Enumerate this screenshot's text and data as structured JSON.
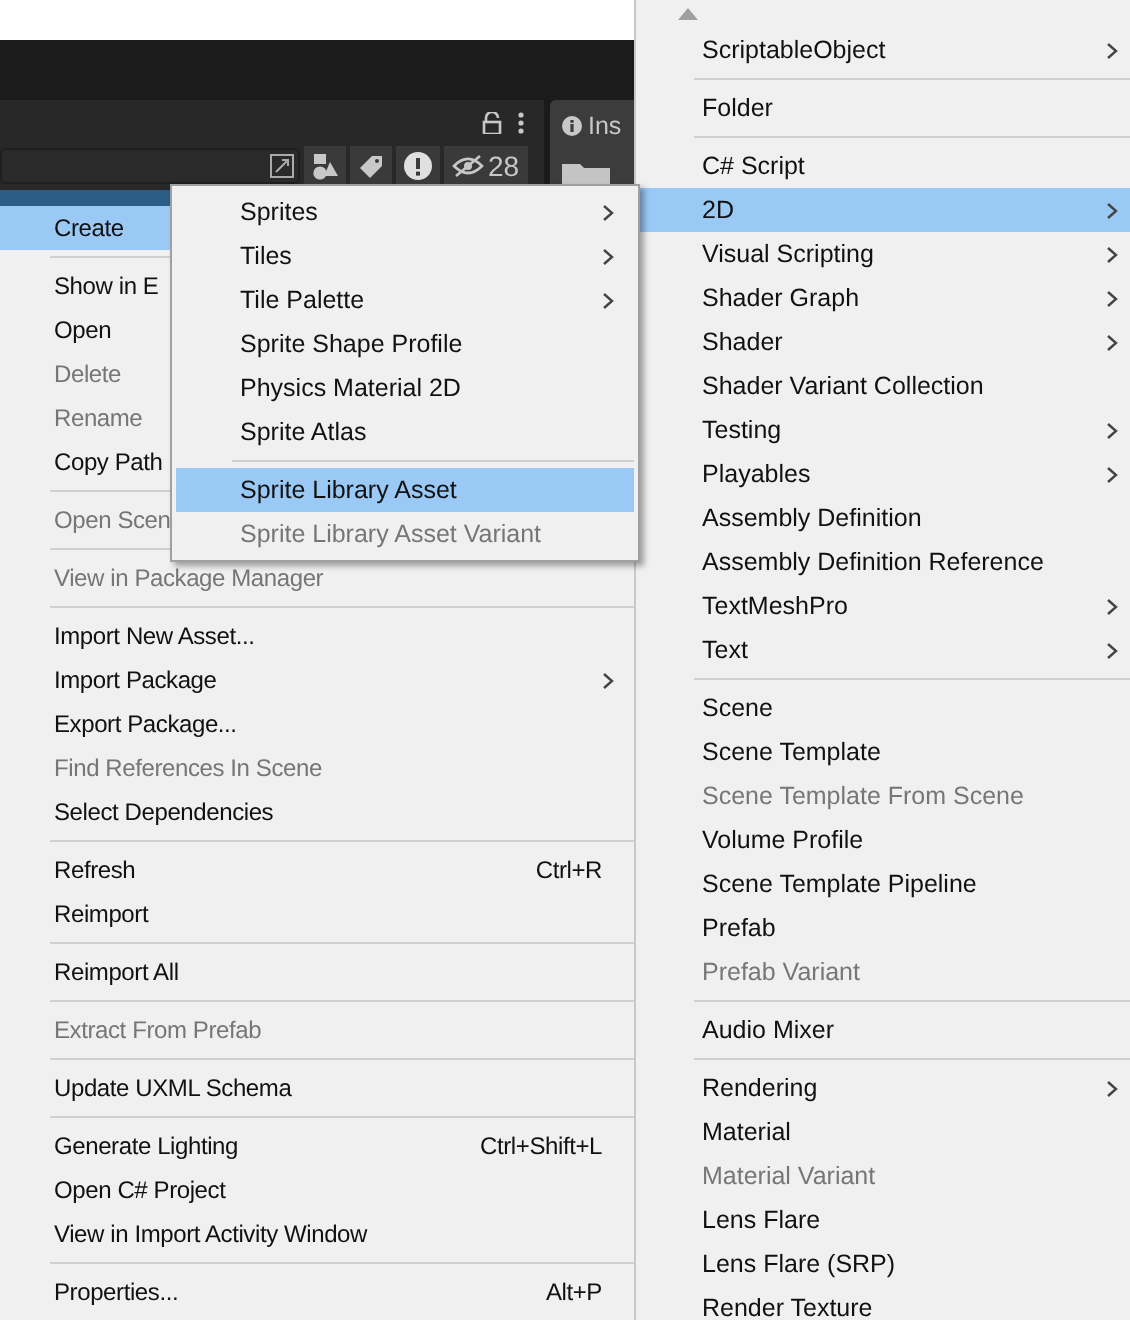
{
  "project_panel": {
    "hidden_count": "28"
  },
  "inspector_tab": {
    "label": "Ins"
  },
  "context_menu": {
    "items": [
      {
        "kind": "item",
        "label": "Create",
        "selected": true,
        "disabled": false,
        "submenu": true
      },
      {
        "kind": "separator"
      },
      {
        "kind": "item",
        "label": "Show in E",
        "selected": false,
        "disabled": false,
        "submenu": false
      },
      {
        "kind": "item",
        "label": "Open",
        "selected": false,
        "disabled": false,
        "submenu": false
      },
      {
        "kind": "item",
        "label": "Delete",
        "selected": false,
        "disabled": true,
        "submenu": false
      },
      {
        "kind": "item",
        "label": "Rename",
        "selected": false,
        "disabled": true,
        "submenu": false
      },
      {
        "kind": "item",
        "label": "Copy Path",
        "selected": false,
        "disabled": false,
        "submenu": false
      },
      {
        "kind": "separator"
      },
      {
        "kind": "item",
        "label": "Open Scen",
        "selected": false,
        "disabled": true,
        "submenu": false
      },
      {
        "kind": "separator"
      },
      {
        "kind": "item",
        "label": "View in Package Manager",
        "selected": false,
        "disabled": true,
        "submenu": false
      },
      {
        "kind": "separator"
      },
      {
        "kind": "item",
        "label": "Import New Asset...",
        "selected": false,
        "disabled": false,
        "submenu": false
      },
      {
        "kind": "item",
        "label": "Import Package",
        "selected": false,
        "disabled": false,
        "submenu": true
      },
      {
        "kind": "item",
        "label": "Export Package...",
        "selected": false,
        "disabled": false,
        "submenu": false
      },
      {
        "kind": "item",
        "label": "Find References In Scene",
        "selected": false,
        "disabled": true,
        "submenu": false
      },
      {
        "kind": "item",
        "label": "Select Dependencies",
        "selected": false,
        "disabled": false,
        "submenu": false
      },
      {
        "kind": "separator"
      },
      {
        "kind": "item",
        "label": "Refresh",
        "shortcut": "Ctrl+R",
        "selected": false,
        "disabled": false,
        "submenu": false
      },
      {
        "kind": "item",
        "label": "Reimport",
        "selected": false,
        "disabled": false,
        "submenu": false
      },
      {
        "kind": "separator"
      },
      {
        "kind": "item",
        "label": "Reimport All",
        "selected": false,
        "disabled": false,
        "submenu": false
      },
      {
        "kind": "separator"
      },
      {
        "kind": "item",
        "label": "Extract From Prefab",
        "selected": false,
        "disabled": true,
        "submenu": false
      },
      {
        "kind": "separator"
      },
      {
        "kind": "item",
        "label": "Update UXML Schema",
        "selected": false,
        "disabled": false,
        "submenu": false
      },
      {
        "kind": "separator"
      },
      {
        "kind": "item",
        "label": "Generate Lighting",
        "shortcut": "Ctrl+Shift+L",
        "selected": false,
        "disabled": false,
        "submenu": false
      },
      {
        "kind": "item",
        "label": "Open C# Project",
        "selected": false,
        "disabled": false,
        "submenu": false
      },
      {
        "kind": "item",
        "label": "View in Import Activity Window",
        "selected": false,
        "disabled": false,
        "submenu": false
      },
      {
        "kind": "separator"
      },
      {
        "kind": "item",
        "label": "Properties...",
        "shortcut": "Alt+P",
        "selected": false,
        "disabled": false,
        "submenu": false
      }
    ]
  },
  "create_submenu": {
    "items": [
      {
        "kind": "item",
        "label": "ScriptableObject",
        "selected": false,
        "disabled": false,
        "submenu": true
      },
      {
        "kind": "separator"
      },
      {
        "kind": "item",
        "label": "Folder",
        "selected": false,
        "disabled": false,
        "submenu": false
      },
      {
        "kind": "separator"
      },
      {
        "kind": "item",
        "label": "C# Script",
        "selected": false,
        "disabled": false,
        "submenu": false
      },
      {
        "kind": "item",
        "label": "2D",
        "selected": true,
        "disabled": false,
        "submenu": true
      },
      {
        "kind": "item",
        "label": "Visual Scripting",
        "selected": false,
        "disabled": false,
        "submenu": true
      },
      {
        "kind": "item",
        "label": "Shader Graph",
        "selected": false,
        "disabled": false,
        "submenu": true
      },
      {
        "kind": "item",
        "label": "Shader",
        "selected": false,
        "disabled": false,
        "submenu": true
      },
      {
        "kind": "item",
        "label": "Shader Variant Collection",
        "selected": false,
        "disabled": false,
        "submenu": false
      },
      {
        "kind": "item",
        "label": "Testing",
        "selected": false,
        "disabled": false,
        "submenu": true
      },
      {
        "kind": "item",
        "label": "Playables",
        "selected": false,
        "disabled": false,
        "submenu": true
      },
      {
        "kind": "item",
        "label": "Assembly Definition",
        "selected": false,
        "disabled": false,
        "submenu": false
      },
      {
        "kind": "item",
        "label": "Assembly Definition Reference",
        "selected": false,
        "disabled": false,
        "submenu": false
      },
      {
        "kind": "item",
        "label": "TextMeshPro",
        "selected": false,
        "disabled": false,
        "submenu": true
      },
      {
        "kind": "item",
        "label": "Text",
        "selected": false,
        "disabled": false,
        "submenu": true
      },
      {
        "kind": "separator"
      },
      {
        "kind": "item",
        "label": "Scene",
        "selected": false,
        "disabled": false,
        "submenu": false
      },
      {
        "kind": "item",
        "label": "Scene Template",
        "selected": false,
        "disabled": false,
        "submenu": false
      },
      {
        "kind": "item",
        "label": "Scene Template From Scene",
        "selected": false,
        "disabled": true,
        "submenu": false
      },
      {
        "kind": "item",
        "label": "Volume Profile",
        "selected": false,
        "disabled": false,
        "submenu": false
      },
      {
        "kind": "item",
        "label": "Scene Template Pipeline",
        "selected": false,
        "disabled": false,
        "submenu": false
      },
      {
        "kind": "item",
        "label": "Prefab",
        "selected": false,
        "disabled": false,
        "submenu": false
      },
      {
        "kind": "item",
        "label": "Prefab Variant",
        "selected": false,
        "disabled": true,
        "submenu": false
      },
      {
        "kind": "separator"
      },
      {
        "kind": "item",
        "label": "Audio Mixer",
        "selected": false,
        "disabled": false,
        "submenu": false
      },
      {
        "kind": "separator"
      },
      {
        "kind": "item",
        "label": "Rendering",
        "selected": false,
        "disabled": false,
        "submenu": true
      },
      {
        "kind": "item",
        "label": "Material",
        "selected": false,
        "disabled": false,
        "submenu": false
      },
      {
        "kind": "item",
        "label": "Material Variant",
        "selected": false,
        "disabled": true,
        "submenu": false
      },
      {
        "kind": "item",
        "label": "Lens Flare",
        "selected": false,
        "disabled": false,
        "submenu": false
      },
      {
        "kind": "item",
        "label": "Lens Flare (SRP)",
        "selected": false,
        "disabled": false,
        "submenu": false
      },
      {
        "kind": "item",
        "label": "Render Texture",
        "selected": false,
        "disabled": false,
        "submenu": false
      }
    ]
  },
  "submenu_2d": {
    "items": [
      {
        "kind": "item",
        "label": "Sprites",
        "selected": false,
        "disabled": false,
        "submenu": true
      },
      {
        "kind": "item",
        "label": "Tiles",
        "selected": false,
        "disabled": false,
        "submenu": true
      },
      {
        "kind": "item",
        "label": "Tile Palette",
        "selected": false,
        "disabled": false,
        "submenu": true
      },
      {
        "kind": "item",
        "label": "Sprite Shape Profile",
        "selected": false,
        "disabled": false,
        "submenu": false
      },
      {
        "kind": "item",
        "label": "Physics Material 2D",
        "selected": false,
        "disabled": false,
        "submenu": false
      },
      {
        "kind": "item",
        "label": "Sprite Atlas",
        "selected": false,
        "disabled": false,
        "submenu": false
      },
      {
        "kind": "separator"
      },
      {
        "kind": "item",
        "label": "Sprite Library Asset",
        "selected": true,
        "disabled": false,
        "submenu": false
      },
      {
        "kind": "item",
        "label": "Sprite Library Asset Variant",
        "selected": false,
        "disabled": true,
        "submenu": false
      }
    ]
  }
}
